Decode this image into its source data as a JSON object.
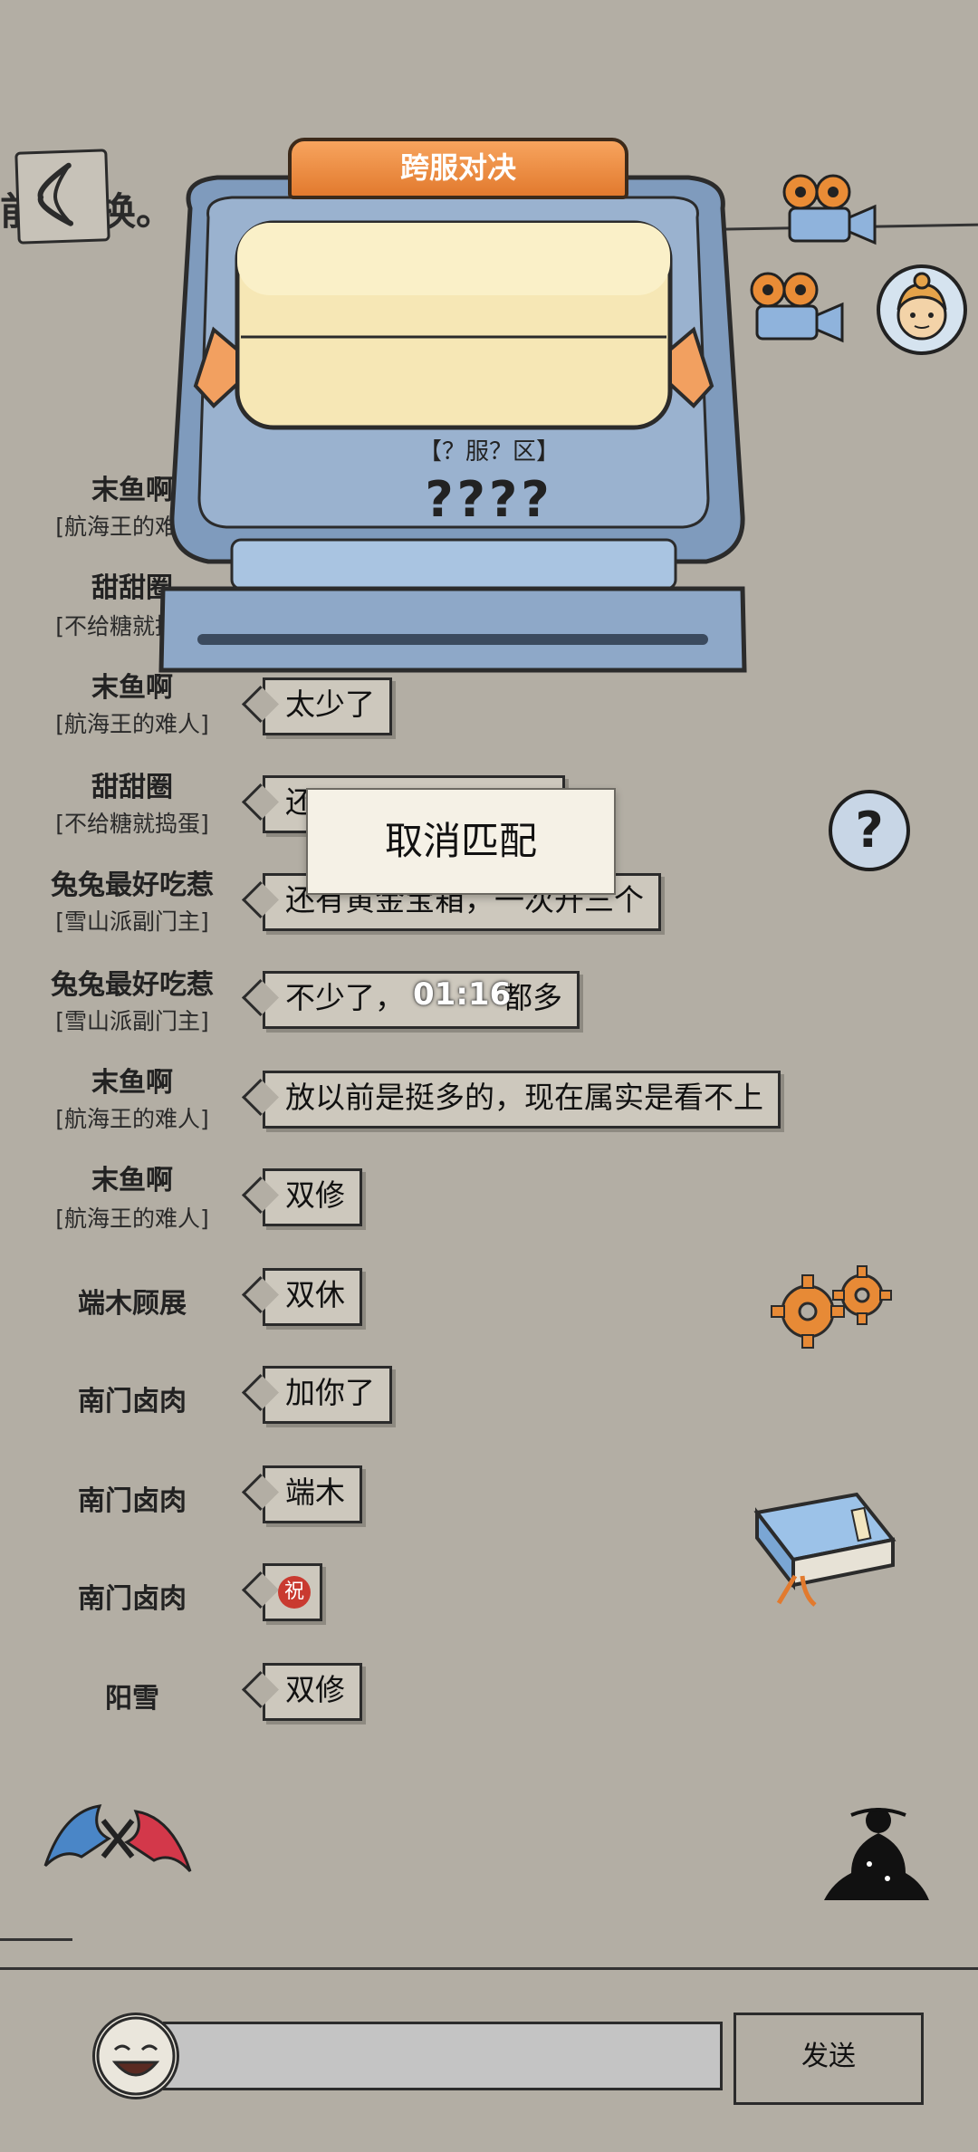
{
  "header": {
    "partial_text_left": "前",
    "partial_text_right": "换。"
  },
  "machine": {
    "title": "跨服对决",
    "server_label": "【？服？区】",
    "player_name": "????"
  },
  "overlay": {
    "cancel_label": "取消匹配",
    "timer": "01:16"
  },
  "chat": [
    {
      "name": "末鱼啊",
      "title": "[航海王的难人]",
      "message": ""
    },
    {
      "name": "甜甜圈",
      "title": "[不给糖就捣蛋]",
      "message": ""
    },
    {
      "name": "末鱼啊",
      "title": "[航海王的难人]",
      "message": "太少了"
    },
    {
      "name": "甜甜圈",
      "title": "[不给糖就捣蛋]",
      "message": "还"
    },
    {
      "name": "兔兔最好吃惹",
      "title": "[雪山派副门主]",
      "message": "还有黄金宝箱，一次开三个"
    },
    {
      "name": "兔兔最好吃惹",
      "title": "[雪山派副门主]",
      "message": "不少了，",
      "message_end": "都多"
    },
    {
      "name": "末鱼啊",
      "title": "[航海王的难人]",
      "message": "放以前是挺多的，现在属实是看不上"
    },
    {
      "name": "末鱼啊",
      "title": "[航海王的难人]",
      "message": "双修"
    },
    {
      "name": "端木顾展",
      "title": "",
      "message": "双休"
    },
    {
      "name": "南门卤肉",
      "title": "",
      "message": "加你了"
    },
    {
      "name": "南门卤肉",
      "title": "",
      "message": "端木"
    },
    {
      "name": "南门卤肉",
      "title": "",
      "message": "祝"
    },
    {
      "name": "阳雪",
      "title": "",
      "message": "双修"
    }
  ],
  "input": {
    "send_label": "发送",
    "placeholder": ""
  },
  "icons": {
    "help": "?"
  }
}
